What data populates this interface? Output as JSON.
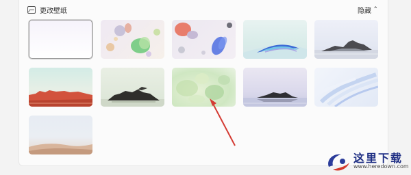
{
  "section": {
    "title": "更改壁纸",
    "hide_label": "隐藏",
    "chevron": "^"
  },
  "wallpapers": [
    {
      "id": "blank",
      "selected": true
    },
    {
      "id": "pastel-shapes"
    },
    {
      "id": "glass-shapes"
    },
    {
      "id": "blue-wave"
    },
    {
      "id": "rock-island"
    },
    {
      "id": "red-cliffs"
    },
    {
      "id": "dark-island"
    },
    {
      "id": "green-flower"
    },
    {
      "id": "lake-rock"
    },
    {
      "id": "blue-swirl"
    },
    {
      "id": "sand-dunes"
    }
  ],
  "watermark": {
    "text": "这里下载",
    "url": "www.heredown.com"
  },
  "colors": {
    "arrow": "#d43c34",
    "panel": "#fbfbfb",
    "background": "#f3f3f3"
  }
}
